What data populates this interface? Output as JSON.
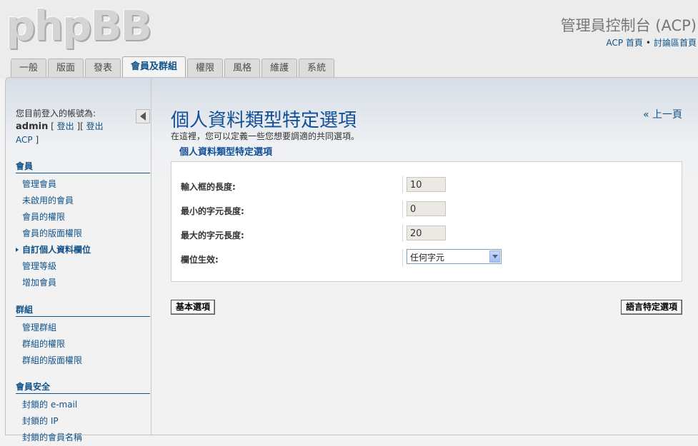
{
  "header": {
    "logo_text": "phpBB",
    "acp_title": "管理員控制台 (ACP)",
    "links": [
      "ACP 首頁",
      "討論區首頁"
    ],
    "link_separator": "•"
  },
  "tabs": [
    {
      "label": "一般",
      "active": false
    },
    {
      "label": "版面",
      "active": false
    },
    {
      "label": "發表",
      "active": false
    },
    {
      "label": "會員及群組",
      "active": true
    },
    {
      "label": "權限",
      "active": false
    },
    {
      "label": "風格",
      "active": false
    },
    {
      "label": "維護",
      "active": false
    },
    {
      "label": "系統",
      "active": false
    }
  ],
  "sidebar": {
    "login_prefix": "您目前登入的帳號為:",
    "username": "admin",
    "logout_label": "登出",
    "logout_acp_label": "登出 ACP",
    "groups": [
      {
        "title": "會員",
        "items": [
          "管理會員",
          "未啟用的會員",
          "會員的權限",
          "會員的版面權限",
          "自訂個人資料欄位",
          "管理等級",
          "增加會員"
        ],
        "active_index": 4
      },
      {
        "title": "群組",
        "items": [
          "管理群組",
          "群組的權限",
          "群組的版面權限"
        ]
      },
      {
        "title": "會員安全",
        "items": [
          "封鎖的 e-mail",
          "封鎖的 IP",
          "封鎖的會員名稱"
        ]
      }
    ]
  },
  "content": {
    "title": "個人資料類型特定選項",
    "description": "在這裡，您可以定義一些您想要調適的共同選項。",
    "back_link": "« 上一頁",
    "legend": "個人資料類型特定選項",
    "fields": [
      {
        "label": "輸入框的長度:",
        "type": "text",
        "value": "10"
      },
      {
        "label": "最小的字元長度:",
        "type": "text",
        "value": "0"
      },
      {
        "label": "最大的字元長度:",
        "type": "text",
        "value": "20"
      },
      {
        "label": "欄位生效:",
        "type": "select",
        "value": "任何字元"
      }
    ],
    "buttons": {
      "basic": "基本選項",
      "language": "語言特定選項"
    }
  }
}
